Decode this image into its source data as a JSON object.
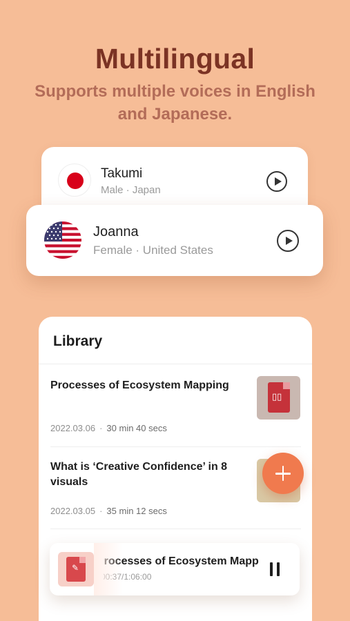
{
  "hero": {
    "title": "Multilingual",
    "subtitle": "Supports multiple voices in English and Japanese."
  },
  "voices": [
    {
      "name": "Takumi",
      "meta": "Male · Japan",
      "flag_icon": "japan-flag-icon"
    },
    {
      "name": "Joanna",
      "meta": "Female · United States",
      "flag_icon": "usa-flag-icon"
    }
  ],
  "library": {
    "title": "Library",
    "items": [
      {
        "title": "Processes of Ecosystem Mapping",
        "date": "2022.03.06",
        "duration": "30 min 40 secs",
        "thumb_icon": "pdf-icon"
      },
      {
        "title": "What is ‘Creative Confidence’ in 8 visuals",
        "date": "2022.03.05",
        "duration": "35 min 12 secs",
        "thumb_icon": "pdf-icon"
      }
    ]
  },
  "player": {
    "title": "Processes of Ecosystem Mapping",
    "time": "00:37/1:06:00"
  },
  "colors": {
    "background": "#f6bd97",
    "headline": "#7b3324",
    "subheadline": "#b36c58",
    "accent": "#f07a4e"
  }
}
